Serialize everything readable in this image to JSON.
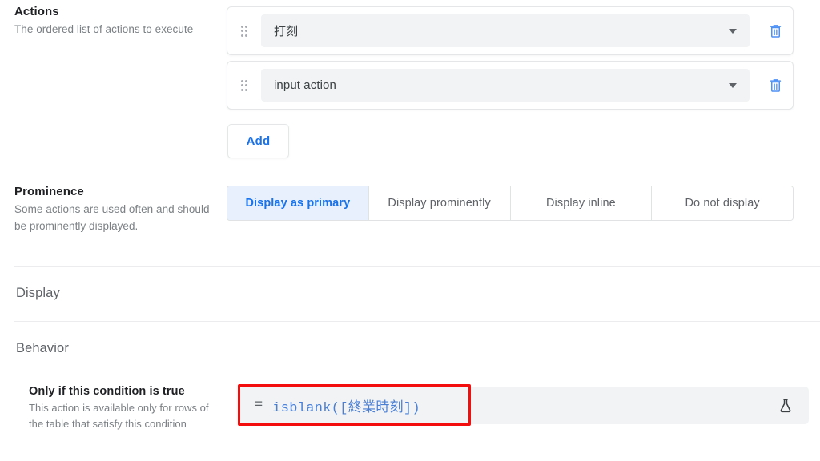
{
  "actions": {
    "title": "Actions",
    "description": "The ordered list of actions to execute",
    "rows": [
      {
        "value": "打刻",
        "caret_icon": "chevron-down-icon",
        "delete_icon": "trash-icon",
        "drag_icon": "drag-handle-icon"
      },
      {
        "value": "input action",
        "caret_icon": "chevron-down-icon",
        "delete_icon": "trash-icon",
        "drag_icon": "drag-handle-icon"
      }
    ],
    "add_label": "Add"
  },
  "prominence": {
    "title": "Prominence",
    "description": "Some actions are used often and should be prominently displayed.",
    "options": [
      {
        "label": "Display as primary",
        "selected": true
      },
      {
        "label": "Display prominently",
        "selected": false
      },
      {
        "label": "Display inline",
        "selected": false
      },
      {
        "label": "Do not display",
        "selected": false
      }
    ],
    "selected": "Display as primary"
  },
  "sections": {
    "display": "Display",
    "behavior": "Behavior"
  },
  "condition": {
    "title": "Only if this condition is true",
    "description": "This action is available only for rows of the table that satisfy this condition",
    "equals_sign": "=",
    "formula": "isblank([終業時刻])",
    "test_icon": "flask-icon"
  },
  "colors": {
    "accent_blue": "#1a73e8",
    "selected_segment_bg": "#e8f0fe",
    "field_bg": "#f1f3f4",
    "formula_text": "#4a7fd4",
    "annotation_red": "#f40d0d",
    "trash_blue": "#4e91f5"
  }
}
